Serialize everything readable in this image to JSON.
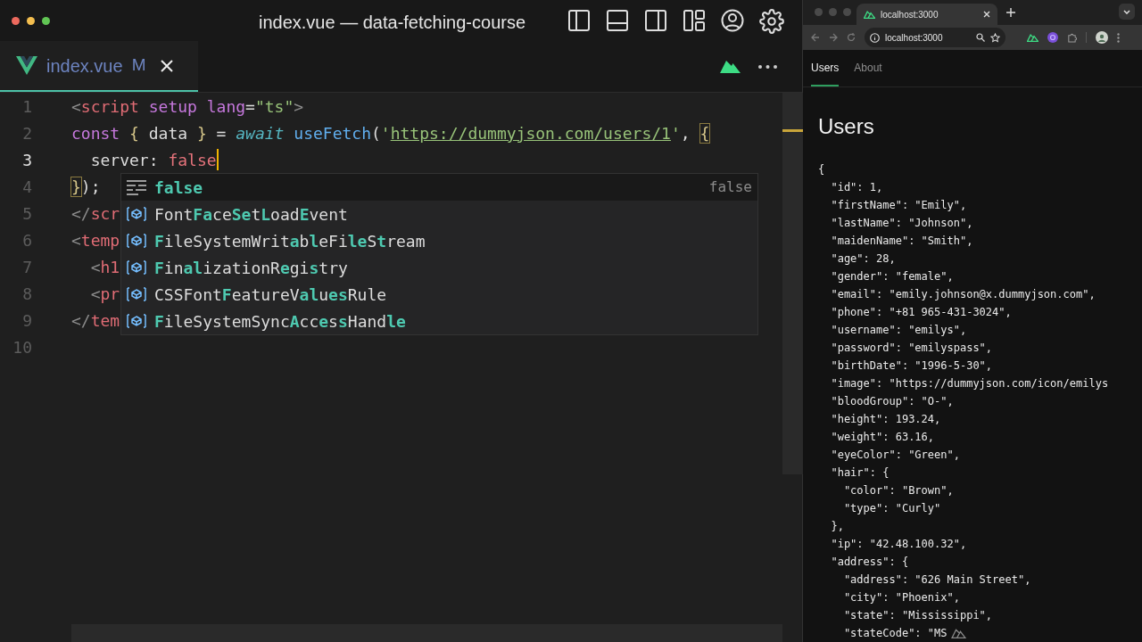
{
  "window_title": "index.vue — data-fetching-course",
  "editor": {
    "tab": {
      "label": "index.vue",
      "status": "M"
    },
    "lines": [
      {
        "number": "1",
        "current": false,
        "cursor": false,
        "tokens": [
          {
            "text": "<",
            "kind": "punct"
          },
          {
            "text": "script",
            "kind": "tag"
          },
          {
            "text": " setup",
            "kind": "attr"
          },
          {
            "text": " lang",
            "kind": "attr"
          },
          {
            "text": "=",
            "kind": "plain"
          },
          {
            "text": "\"ts\"",
            "kind": "string"
          },
          {
            "text": ">",
            "kind": "punct"
          }
        ]
      },
      {
        "number": "2",
        "current": false,
        "cursor": false,
        "tokens": [
          {
            "text": "const ",
            "kind": "keyword"
          },
          {
            "text": "{",
            "kind": "brace"
          },
          {
            "text": " data ",
            "kind": "plain"
          },
          {
            "text": "}",
            "kind": "brace"
          },
          {
            "text": " = ",
            "kind": "plain"
          },
          {
            "text": "await",
            "kind": "await"
          },
          {
            "text": " useFetch",
            "kind": "func"
          },
          {
            "text": "(",
            "kind": "plain"
          },
          {
            "text": "'",
            "kind": "string"
          },
          {
            "text": "https://dummyjson.com/users/1",
            "kind": "url"
          },
          {
            "text": "'",
            "kind": "string"
          },
          {
            "text": ", ",
            "kind": "plain"
          },
          {
            "text": "{",
            "kind": "match"
          }
        ]
      },
      {
        "number": "3",
        "current": true,
        "cursor": true,
        "tokens": [
          {
            "text": "  server: ",
            "kind": "plain"
          },
          {
            "text": "false",
            "kind": "bool"
          }
        ]
      },
      {
        "number": "4",
        "current": false,
        "cursor": false,
        "tokens": [
          {
            "text": "}",
            "kind": "match"
          },
          {
            "text": ");",
            "kind": "plain"
          }
        ]
      },
      {
        "number": "5",
        "current": false,
        "cursor": false,
        "tokens": [
          {
            "text": "</",
            "kind": "punct"
          },
          {
            "text": "scr",
            "kind": "tag"
          }
        ]
      },
      {
        "number": "6",
        "current": false,
        "cursor": false,
        "tokens": [
          {
            "text": "<",
            "kind": "punct"
          },
          {
            "text": "temp",
            "kind": "tag"
          }
        ]
      },
      {
        "number": "7",
        "current": false,
        "cursor": false,
        "tokens": [
          {
            "text": "  <",
            "kind": "punct"
          },
          {
            "text": "h1",
            "kind": "tag"
          }
        ]
      },
      {
        "number": "8",
        "current": false,
        "cursor": false,
        "tokens": [
          {
            "text": "  <",
            "kind": "punct"
          },
          {
            "text": "pr",
            "kind": "tag"
          }
        ]
      },
      {
        "number": "9",
        "current": false,
        "cursor": false,
        "tokens": [
          {
            "text": "</",
            "kind": "punct"
          },
          {
            "text": "tem",
            "kind": "tag"
          }
        ]
      },
      {
        "number": "10",
        "current": false,
        "cursor": false
      }
    ],
    "suggestions": [
      {
        "kind": "keyword",
        "label": "false",
        "detail": "false",
        "selected": true
      },
      {
        "kind": "class",
        "label": "Font**Fa**ce**Se**t**L**oad**E**vent",
        "selected": false
      },
      {
        "kind": "class",
        "label": "**F**ileSystemWrit**a**b**l**eFi**le**S**t**ream",
        "selected": false
      },
      {
        "kind": "class",
        "label": "**F**in**al**izationR**e**gi**s**try",
        "selected": false
      },
      {
        "kind": "class",
        "label": "CSSFont**F**eatureV**al**u**es**Rule",
        "selected": false
      },
      {
        "kind": "class",
        "label": "**F**ileSystemSync**A**cc**e**s**s**Hand**le**",
        "selected": false
      }
    ]
  },
  "browser": {
    "tab_title": "localhost:3000",
    "address": "localhost:3000",
    "nav": [
      {
        "label": "Users",
        "selected": true
      },
      {
        "label": "About",
        "selected": false
      }
    ],
    "heading": "Users",
    "json_lines": [
      "{",
      "  \"id\": 1,",
      "  \"firstName\": \"Emily\",",
      "  \"lastName\": \"Johnson\",",
      "  \"maidenName\": \"Smith\",",
      "  \"age\": 28,",
      "  \"gender\": \"female\",",
      "  \"email\": \"emily.johnson@x.dummyjson.com\",",
      "  \"phone\": \"+81 965-431-3024\",",
      "  \"username\": \"emilys\",",
      "  \"password\": \"emilyspass\",",
      "  \"birthDate\": \"1996-5-30\",",
      "  \"image\": \"https://dummyjson.com/icon/emilys",
      "  \"bloodGroup\": \"O-\",",
      "  \"height\": 193.24,",
      "  \"weight\": 63.16,",
      "  \"eyeColor\": \"Green\",",
      "  \"hair\": {",
      "    \"color\": \"Brown\",",
      "    \"type\": \"Curly\"",
      "  },",
      "  \"ip\": \"42.48.100.32\",",
      "  \"address\": {",
      "    \"address\": \"626 Main Street\",",
      "    \"city\": \"Phoenix\",",
      "    \"state\": \"Mississippi\",",
      "    \"stateCode\": \"MS"
    ]
  }
}
